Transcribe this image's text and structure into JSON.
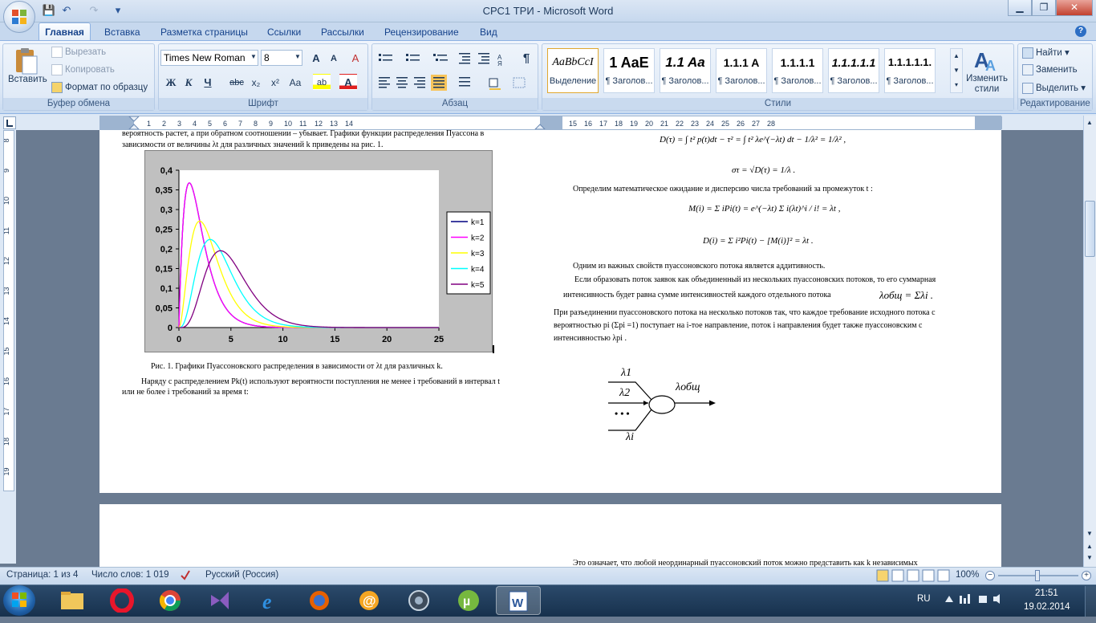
{
  "window": {
    "title": "СРС1 ТРИ - Microsoft Word",
    "minimize": "▁",
    "maximize": "❐",
    "close": "✕"
  },
  "qat": {
    "save": "💾",
    "undo": "↶",
    "redo": "↷",
    "more": "▾"
  },
  "tabs": [
    "Главная",
    "Вставка",
    "Разметка страницы",
    "Ссылки",
    "Рассылки",
    "Рецензирование",
    "Вид"
  ],
  "clipboard": {
    "label": "Буфер обмена",
    "paste": "Вставить",
    "cut": "Вырезать",
    "copy": "Копировать",
    "format_painter": "Формат по образцу"
  },
  "font": {
    "label": "Шрифт",
    "family": "Times New Roman",
    "size": "8",
    "grow": "A",
    "shrink": "A",
    "clear": "A",
    "bold": "Ж",
    "italic": "К",
    "underline": "Ч",
    "strike": "abc",
    "sub": "x₂",
    "sup": "x²",
    "case": "Aa",
    "highlight": "ab",
    "color": "A"
  },
  "paragraph": {
    "label": "Абзац",
    "pilcrow": "¶"
  },
  "styles": {
    "label": "Стили",
    "items": [
      {
        "sample": "AaBbCcI",
        "name": "Выделение"
      },
      {
        "sample": "1 AaE",
        "name": "¶ Заголов..."
      },
      {
        "sample": "1.1 Aa",
        "name": "¶ Заголов..."
      },
      {
        "sample": "1.1.1 A",
        "name": "¶ Заголов..."
      },
      {
        "sample": "1.1.1.1",
        "name": "¶ Заголов..."
      },
      {
        "sample": "1.1.1.1.1",
        "name": "¶ Заголов..."
      },
      {
        "sample": "1.1.1.1.1.",
        "name": "¶ Заголов..."
      }
    ],
    "change": "Изменить стили"
  },
  "editing": {
    "label": "Редактирование",
    "find": "Найти",
    "replace": "Заменить",
    "select": "Выделить"
  },
  "ruler": {
    "left_ticks": [
      "1",
      "2",
      "3",
      "4",
      "5",
      "6",
      "7",
      "8",
      "9",
      "10",
      "11",
      "12",
      "13",
      "14"
    ],
    "right_ticks": [
      "15",
      "16",
      "17",
      "18",
      "19",
      "20",
      "21",
      "22",
      "23",
      "24",
      "25",
      "26",
      "27",
      "28"
    ],
    "vertical_ticks": [
      "8",
      "9",
      "10",
      "11",
      "12",
      "13",
      "14",
      "15",
      "16",
      "17",
      "18",
      "19"
    ]
  },
  "doc": {
    "left_line1": "вероятность растет, а при обратном соотношении – убывает. Графики функции распределения Пуассона в",
    "left_line2": "зависимости от величины λt для различных значений  k приведены на рис. 1.",
    "caption": "Рис. 1. Графики Пуассоновского распределения в зависимости от λt для различных k.",
    "left_p2_line1": "Наряду с распределением Pk(t) используют  вероятности поступления не менее  i  требований в интервал  t",
    "left_p2_line2": "или не более  i  требований  за  время   t:",
    "r_formula1": "D(τ) = ∫ t² p(t)dt − τ² = ∫ t² λe^(−λt) dt − 1/λ² = 1/λ² ,",
    "r_formula2": "στ = √D(τ) = 1/λ .",
    "r_text1": "Определим математическое ожидание и дисперсию числа  требований за промежуток t :",
    "r_formula3": "M(i) = Σ iPi(t) = e^(−λt) Σ i(λt)^i / i! = λt ,",
    "r_formula4": "D(i) = Σ i²Pi(t) − [M(i)]² = λt .",
    "r_text2": "Одним из важных свойств пуассоновского потока является аддитивность.",
    "r_text3_line1": "Если образовать поток заявок как объединенный из нескольких пуассоновских потоков, то его суммарная",
    "r_text3_line2": "интенсивность будет равна сумме интенсивностей каждого отдельного потока",
    "r_formula5": "λобщ = Σλi .",
    "r_text4_line1": "При разъединении пуассоновского потока на несколько потоков так, что каждое требование исходного потока с",
    "r_text4_line2": "вероятностью pi (Σpi =1)  поступает на  i-тое  направление, поток i направления будет также пуассоновским с",
    "r_text4_line3": "интенсивностью λpi .",
    "diagram": {
      "l1": "λ1",
      "l2": "λ2",
      "dots": "• • •",
      "li": "λi",
      "out": "λобщ"
    },
    "page2_text": "Это означает, что любой неординарный пуассоновский поток можно представить как  k независимых"
  },
  "chart_data": {
    "type": "line",
    "title": "",
    "xlabel": "",
    "ylabel": "",
    "xlim": [
      0,
      25
    ],
    "ylim": [
      0,
      0.4
    ],
    "x_ticks": [
      "0",
      "5",
      "10",
      "15",
      "20",
      "25"
    ],
    "y_ticks": [
      "0",
      "0,05",
      "0,1",
      "0,15",
      "0,2",
      "0,25",
      "0,3",
      "0,35",
      "0,4"
    ],
    "legend_position": "right",
    "grid": false,
    "series": [
      {
        "name": "k=1",
        "color": "#000080",
        "k": 1
      },
      {
        "name": "k=2",
        "color": "#ff00ff",
        "k": 2
      },
      {
        "name": "k=3",
        "color": "#ffff00",
        "k": 3
      },
      {
        "name": "k=4",
        "color": "#00ffff",
        "k": 4
      },
      {
        "name": "k=5",
        "color": "#800080",
        "k": 5
      }
    ]
  },
  "status": {
    "page": "Страница: 1 из 4",
    "words": "Число слов: 1 019",
    "lang": "Русский (Россия)",
    "zoom": "100%"
  },
  "tray": {
    "lang": "RU",
    "time": "21:51",
    "date": "19.02.2014"
  }
}
